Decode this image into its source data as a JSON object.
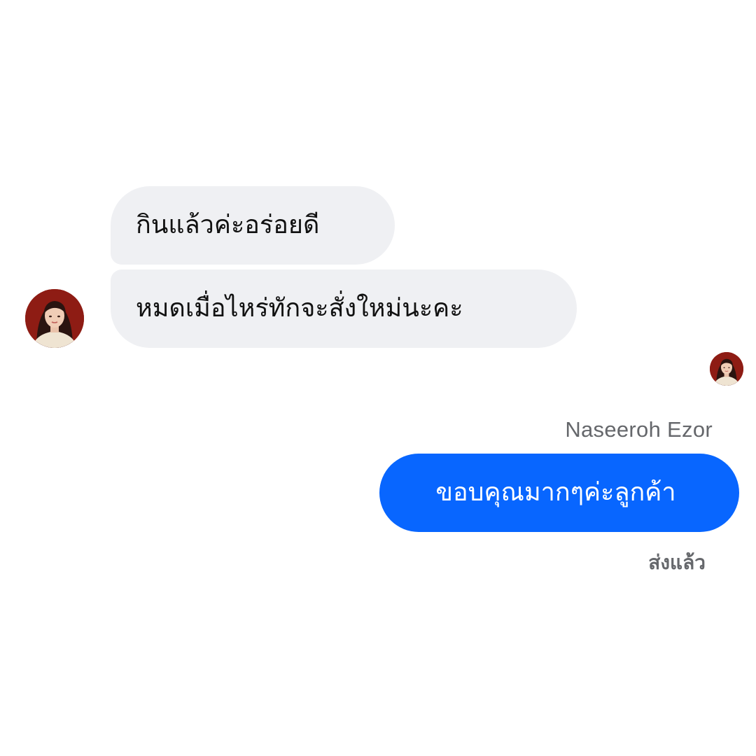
{
  "messages": {
    "incoming": [
      {
        "text": "กินแล้วค่ะอร่อยดี"
      },
      {
        "text": "หมดเมื่อไหร่ทักจะสั่งใหม่นะคะ"
      }
    ],
    "outgoing": [
      {
        "sender": "Naseeroh Ezor",
        "text": "ขอบคุณมากๆค่ะลูกค้า",
        "status": "ส่งแล้ว"
      }
    ]
  },
  "icons": {
    "contact_avatar": "contact-avatar-icon",
    "seen_avatar": "seen-avatar-icon"
  },
  "colors": {
    "incoming_bubble": "#eff0f3",
    "outgoing_bubble": "#0866ff",
    "meta_text": "#65676b",
    "avatar_background": "#8e1c14"
  }
}
